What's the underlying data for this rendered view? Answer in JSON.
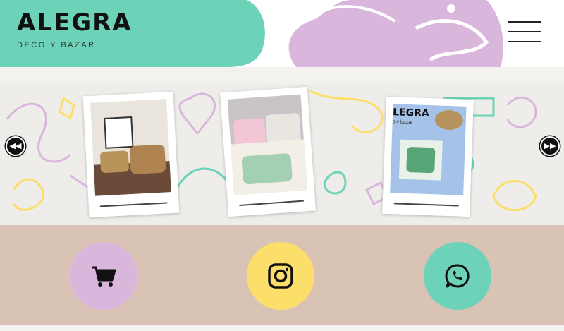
{
  "brand": {
    "name": "ALEGRA",
    "tagline": "DECO Y BAZAR"
  },
  "colors": {
    "mint": "#6dd3b8",
    "lavender": "#d9b7dc",
    "yellow": "#fbdf6a",
    "footer_bg": "#d8c3b4",
    "gallery_bg": "#efedea",
    "cream": "#f4f2ee"
  },
  "header": {
    "menu_icon": "hamburger-icon"
  },
  "gallery": {
    "prev_icon": "rewind-icon",
    "next_icon": "fast-forward-icon",
    "prev_glyph": "◀◀",
    "next_glyph": "▶▶",
    "photos": [
      {
        "subject": "woven-baskets"
      },
      {
        "subject": "floral-cushions"
      },
      {
        "subject": "tropical-print-placemats",
        "overlay_text": "LEGRA",
        "overlay_sub": "o y bazar"
      }
    ]
  },
  "social": [
    {
      "name": "cart",
      "icon": "shopping-cart-icon",
      "color": "#d9b7dc"
    },
    {
      "name": "instagram",
      "icon": "instagram-icon",
      "color": "#fbdf6a"
    },
    {
      "name": "whatsapp",
      "icon": "whatsapp-icon",
      "color": "#6dd3b8"
    }
  ]
}
